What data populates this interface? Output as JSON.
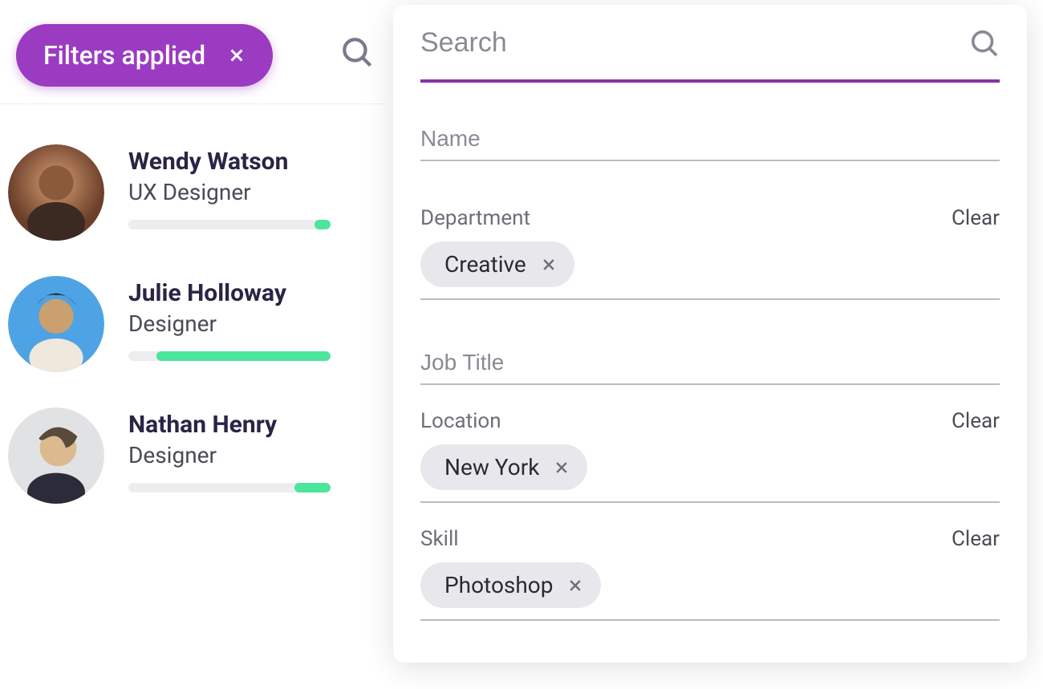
{
  "header": {
    "filters_chip_label": "Filters applied"
  },
  "people": [
    {
      "name": "Wendy Watson",
      "title": "UX Designer",
      "bar_pct": 8
    },
    {
      "name": "Julie Holloway",
      "title": "Designer",
      "bar_pct": 86
    },
    {
      "name": "Nathan Henry",
      "title": "Designer",
      "bar_pct": 18
    }
  ],
  "avatar_colors": [
    [
      "#6b3f2a",
      "#d79e73"
    ],
    [
      "#4ea3e4",
      "#2b2b3a"
    ],
    [
      "#cfd2d5",
      "#7a6d5e"
    ]
  ],
  "panel": {
    "search_placeholder": "Search",
    "clear_label": "Clear",
    "fields": {
      "name": {
        "placeholder": "Name"
      },
      "department": {
        "label": "Department",
        "chip": "Creative"
      },
      "job_title": {
        "placeholder": "Job Title"
      },
      "location": {
        "label": "Location",
        "chip": "New York"
      },
      "skill": {
        "label": "Skill",
        "chip": "Photoshop"
      }
    }
  }
}
